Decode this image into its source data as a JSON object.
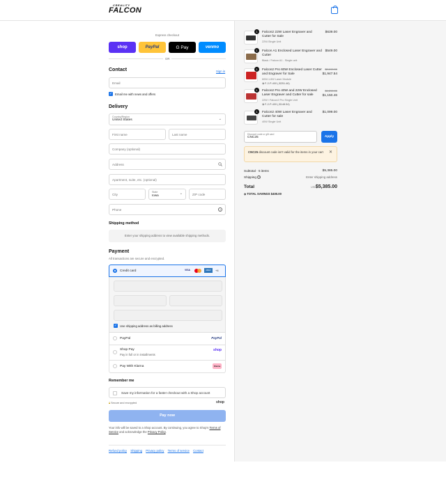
{
  "header": {
    "logo_top": "CREALITY",
    "logo_main": "FALCON"
  },
  "express": {
    "title": "Express checkout",
    "shop": "shop",
    "paypal": "PayPal",
    "gpay": "G Pay",
    "venmo": "venmo",
    "or": "OR"
  },
  "contact": {
    "title": "Contact",
    "sign_in": "Sign in",
    "email_placeholder": "Email",
    "news_label": "Email me with news and offers"
  },
  "delivery": {
    "title": "Delivery",
    "country_label": "Country/Region",
    "country_value": "United States",
    "first_name": "First name",
    "last_name": "Last name",
    "company": "Company (optional)",
    "address": "Address",
    "apartment": "Apartment, suite, etc. (optional)",
    "city": "City",
    "state_label": "State",
    "state_value": "Iowa",
    "zip": "ZIP code",
    "phone": "Phone"
  },
  "shipping_method": {
    "title": "Shipping method",
    "message": "Enter your shipping address to view available shipping methods."
  },
  "payment": {
    "title": "Payment",
    "subtitle": "All transactions are secure and encrypted.",
    "credit_card": "Credit card",
    "card_brands": [
      "VISA",
      "MC",
      "AMEX",
      "+4"
    ],
    "billing_label": "Use shipping address as billing address",
    "paypal": "PayPal",
    "paypal_logo": "PayPal",
    "shop_pay": "Shop Pay",
    "shop_pay_sub": "Pay in full or in installments",
    "shop_logo": "shop",
    "klarna": "Pay With Klarna",
    "klarna_logo": "Klarna"
  },
  "remember": {
    "title": "Remember me",
    "save_label": "Save my information for a faster checkout with a Shop account",
    "secure": "Secure and encrypted",
    "shop_logo": "shop"
  },
  "pay_button": "Pay now",
  "disclaimer": {
    "part1": "Your info will be saved to a Shop account. By continuing, you agree to Shop's",
    "terms": "Terms of Service",
    "part2": "and acknowledge the",
    "privacy": "Privacy Policy",
    "end": "."
  },
  "footer_links": [
    "Refund policy",
    "Shipping",
    "Privacy policy",
    "Terms of service",
    "Contact"
  ],
  "cart": {
    "items": [
      {
        "qty": "1",
        "title": "Falcon2 22W Laser Engraver and Cutter for Sale",
        "variant": "22W-Single Unit",
        "price": "$639.00",
        "old_price": ""
      },
      {
        "qty": "1",
        "title": "Falcon A1 Enclosed Laser Engraver and Cutter",
        "variant": "Black / Falcon A1 - Single unit",
        "price": "$549.00",
        "old_price": ""
      },
      {
        "qty": "1",
        "title": "Falcon2 Pro 60W Enclosed Laser Cutter and Engraver for Sale",
        "variant": "60W-1.6W Laser Module",
        "discount": "F-2-P-400 (-$251.46)",
        "price": "$1,947.54",
        "old_price": "$2,199.00"
      },
      {
        "qty": "1",
        "title": "Falcon2 Pro 40W and 22W Enclosed Laser Engraver and Cutter for sale",
        "variant": "22W / Falcon2 Pro Single Unit",
        "discount": "F-2-P-400 (-$148.54)",
        "price": "$1,150.46",
        "old_price": "$1,299.00"
      },
      {
        "qty": "1",
        "title": "Falcon2 40W Laser Engraver and Cutter for sale",
        "variant": "40W Single Unit",
        "price": "$1,099.00",
        "old_price": ""
      }
    ],
    "discount_label": "Discount code or gift card",
    "discount_value": "CNC25",
    "apply": "Apply",
    "error_code": "CNC25",
    "error_msg": "discount code isn't valid for the items in your cart",
    "subtotal_label": "Subtotal · 5 items",
    "subtotal": "$5,385.00",
    "shipping_label": "Shipping",
    "shipping_value": "Enter shipping address",
    "total_label": "Total",
    "currency": "USD",
    "total": "$5,385.00",
    "savings_label": "TOTAL SAVINGS",
    "savings": "$400.00"
  }
}
